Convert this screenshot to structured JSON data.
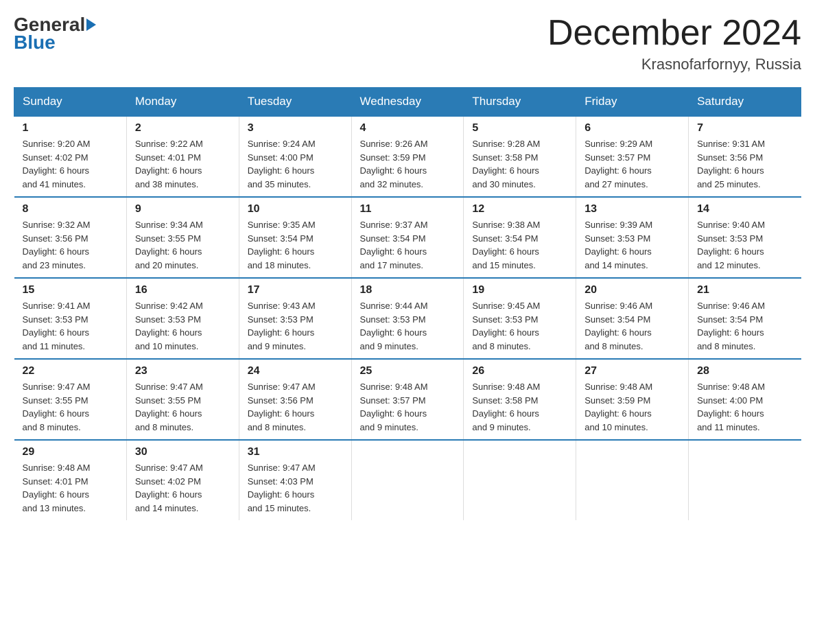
{
  "header": {
    "logo_general": "General",
    "logo_blue": "Blue",
    "month_title": "December 2024",
    "location": "Krasnofarfornyy, Russia"
  },
  "days_of_week": [
    "Sunday",
    "Monday",
    "Tuesday",
    "Wednesday",
    "Thursday",
    "Friday",
    "Saturday"
  ],
  "weeks": [
    [
      {
        "day": "1",
        "sunrise": "9:20 AM",
        "sunset": "4:02 PM",
        "daylight": "6 hours and 41 minutes."
      },
      {
        "day": "2",
        "sunrise": "9:22 AM",
        "sunset": "4:01 PM",
        "daylight": "6 hours and 38 minutes."
      },
      {
        "day": "3",
        "sunrise": "9:24 AM",
        "sunset": "4:00 PM",
        "daylight": "6 hours and 35 minutes."
      },
      {
        "day": "4",
        "sunrise": "9:26 AM",
        "sunset": "3:59 PM",
        "daylight": "6 hours and 32 minutes."
      },
      {
        "day": "5",
        "sunrise": "9:28 AM",
        "sunset": "3:58 PM",
        "daylight": "6 hours and 30 minutes."
      },
      {
        "day": "6",
        "sunrise": "9:29 AM",
        "sunset": "3:57 PM",
        "daylight": "6 hours and 27 minutes."
      },
      {
        "day": "7",
        "sunrise": "9:31 AM",
        "sunset": "3:56 PM",
        "daylight": "6 hours and 25 minutes."
      }
    ],
    [
      {
        "day": "8",
        "sunrise": "9:32 AM",
        "sunset": "3:56 PM",
        "daylight": "6 hours and 23 minutes."
      },
      {
        "day": "9",
        "sunrise": "9:34 AM",
        "sunset": "3:55 PM",
        "daylight": "6 hours and 20 minutes."
      },
      {
        "day": "10",
        "sunrise": "9:35 AM",
        "sunset": "3:54 PM",
        "daylight": "6 hours and 18 minutes."
      },
      {
        "day": "11",
        "sunrise": "9:37 AM",
        "sunset": "3:54 PM",
        "daylight": "6 hours and 17 minutes."
      },
      {
        "day": "12",
        "sunrise": "9:38 AM",
        "sunset": "3:54 PM",
        "daylight": "6 hours and 15 minutes."
      },
      {
        "day": "13",
        "sunrise": "9:39 AM",
        "sunset": "3:53 PM",
        "daylight": "6 hours and 14 minutes."
      },
      {
        "day": "14",
        "sunrise": "9:40 AM",
        "sunset": "3:53 PM",
        "daylight": "6 hours and 12 minutes."
      }
    ],
    [
      {
        "day": "15",
        "sunrise": "9:41 AM",
        "sunset": "3:53 PM",
        "daylight": "6 hours and 11 minutes."
      },
      {
        "day": "16",
        "sunrise": "9:42 AM",
        "sunset": "3:53 PM",
        "daylight": "6 hours and 10 minutes."
      },
      {
        "day": "17",
        "sunrise": "9:43 AM",
        "sunset": "3:53 PM",
        "daylight": "6 hours and 9 minutes."
      },
      {
        "day": "18",
        "sunrise": "9:44 AM",
        "sunset": "3:53 PM",
        "daylight": "6 hours and 9 minutes."
      },
      {
        "day": "19",
        "sunrise": "9:45 AM",
        "sunset": "3:53 PM",
        "daylight": "6 hours and 8 minutes."
      },
      {
        "day": "20",
        "sunrise": "9:46 AM",
        "sunset": "3:54 PM",
        "daylight": "6 hours and 8 minutes."
      },
      {
        "day": "21",
        "sunrise": "9:46 AM",
        "sunset": "3:54 PM",
        "daylight": "6 hours and 8 minutes."
      }
    ],
    [
      {
        "day": "22",
        "sunrise": "9:47 AM",
        "sunset": "3:55 PM",
        "daylight": "6 hours and 8 minutes."
      },
      {
        "day": "23",
        "sunrise": "9:47 AM",
        "sunset": "3:55 PM",
        "daylight": "6 hours and 8 minutes."
      },
      {
        "day": "24",
        "sunrise": "9:47 AM",
        "sunset": "3:56 PM",
        "daylight": "6 hours and 8 minutes."
      },
      {
        "day": "25",
        "sunrise": "9:48 AM",
        "sunset": "3:57 PM",
        "daylight": "6 hours and 9 minutes."
      },
      {
        "day": "26",
        "sunrise": "9:48 AM",
        "sunset": "3:58 PM",
        "daylight": "6 hours and 9 minutes."
      },
      {
        "day": "27",
        "sunrise": "9:48 AM",
        "sunset": "3:59 PM",
        "daylight": "6 hours and 10 minutes."
      },
      {
        "day": "28",
        "sunrise": "9:48 AM",
        "sunset": "4:00 PM",
        "daylight": "6 hours and 11 minutes."
      }
    ],
    [
      {
        "day": "29",
        "sunrise": "9:48 AM",
        "sunset": "4:01 PM",
        "daylight": "6 hours and 13 minutes."
      },
      {
        "day": "30",
        "sunrise": "9:47 AM",
        "sunset": "4:02 PM",
        "daylight": "6 hours and 14 minutes."
      },
      {
        "day": "31",
        "sunrise": "9:47 AM",
        "sunset": "4:03 PM",
        "daylight": "6 hours and 15 minutes."
      },
      null,
      null,
      null,
      null
    ]
  ],
  "labels": {
    "sunrise": "Sunrise:",
    "sunset": "Sunset:",
    "daylight": "Daylight:"
  }
}
